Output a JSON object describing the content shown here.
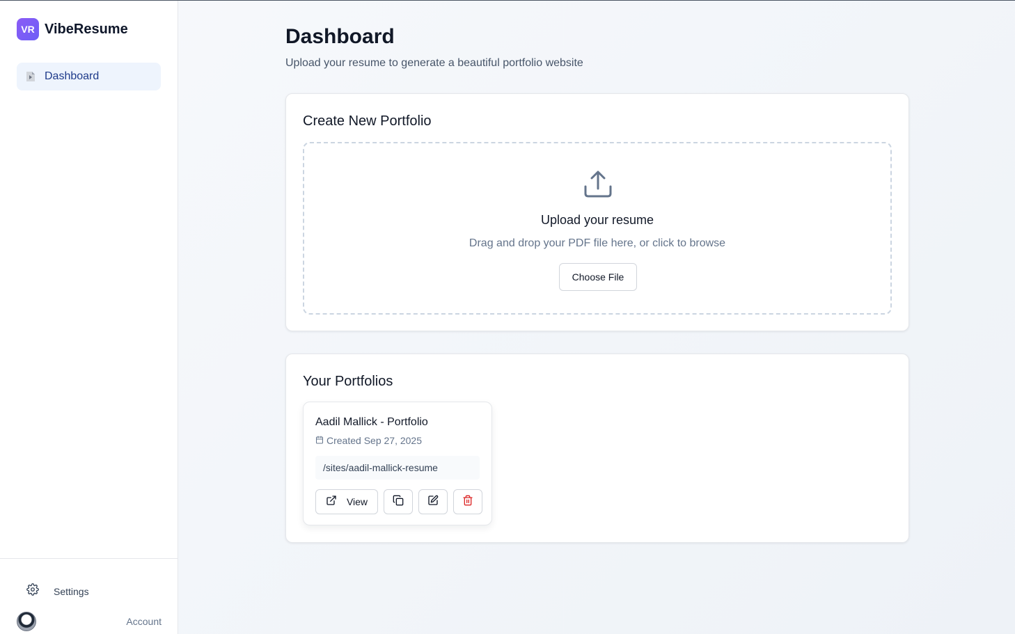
{
  "app": {
    "logo_text": "VR",
    "name": "VibeResume"
  },
  "sidebar": {
    "items": [
      {
        "label": "Dashboard",
        "icon": "document-icon",
        "active": true
      }
    ],
    "settings_label": "Settings",
    "account_label": "Account"
  },
  "main": {
    "title": "Dashboard",
    "subtitle": "Upload your resume to generate a beautiful portfolio website"
  },
  "create": {
    "title": "Create New Portfolio",
    "upload_title": "Upload your resume",
    "upload_hint": "Drag and drop your PDF file here, or click to browse",
    "choose_label": "Choose File"
  },
  "portfolios": {
    "title": "Your Portfolios",
    "items": [
      {
        "title": "Aadil Mallick - Portfolio",
        "created": "Created Sep 27, 2025",
        "path": "/sites/aadil-mallick-resume",
        "view_label": "View"
      }
    ]
  },
  "colors": {
    "accent": "#7c5cf6",
    "active_nav_bg": "#eef4fd",
    "active_nav_text": "#1e3a8a",
    "delete": "#dc2626"
  }
}
